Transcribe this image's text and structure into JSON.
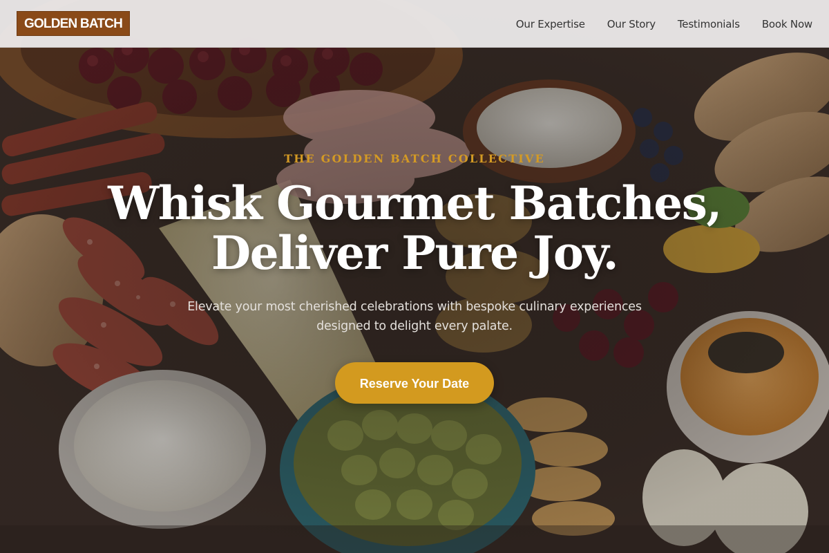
{
  "brand": {
    "logo_text": "GOLDEN BATCH"
  },
  "nav": {
    "items": [
      {
        "label": "Our Expertise"
      },
      {
        "label": "Our Story"
      },
      {
        "label": "Testimonials"
      },
      {
        "label": "Book Now"
      }
    ]
  },
  "hero": {
    "eyebrow": "THE GOLDEN BATCH COLLECTIVE",
    "headline_line1": "Whisk Gourmet Batches,",
    "headline_line2": "Deliver Pure Joy.",
    "subtitle": "Elevate your most cherished celebrations with bespoke culinary experiences designed to delight every palate.",
    "cta_label": "Reserve Your Date"
  },
  "colors": {
    "accent_gold": "#d39a1f",
    "logo_brown": "#8a4a18",
    "nav_background": "#eeecec"
  }
}
